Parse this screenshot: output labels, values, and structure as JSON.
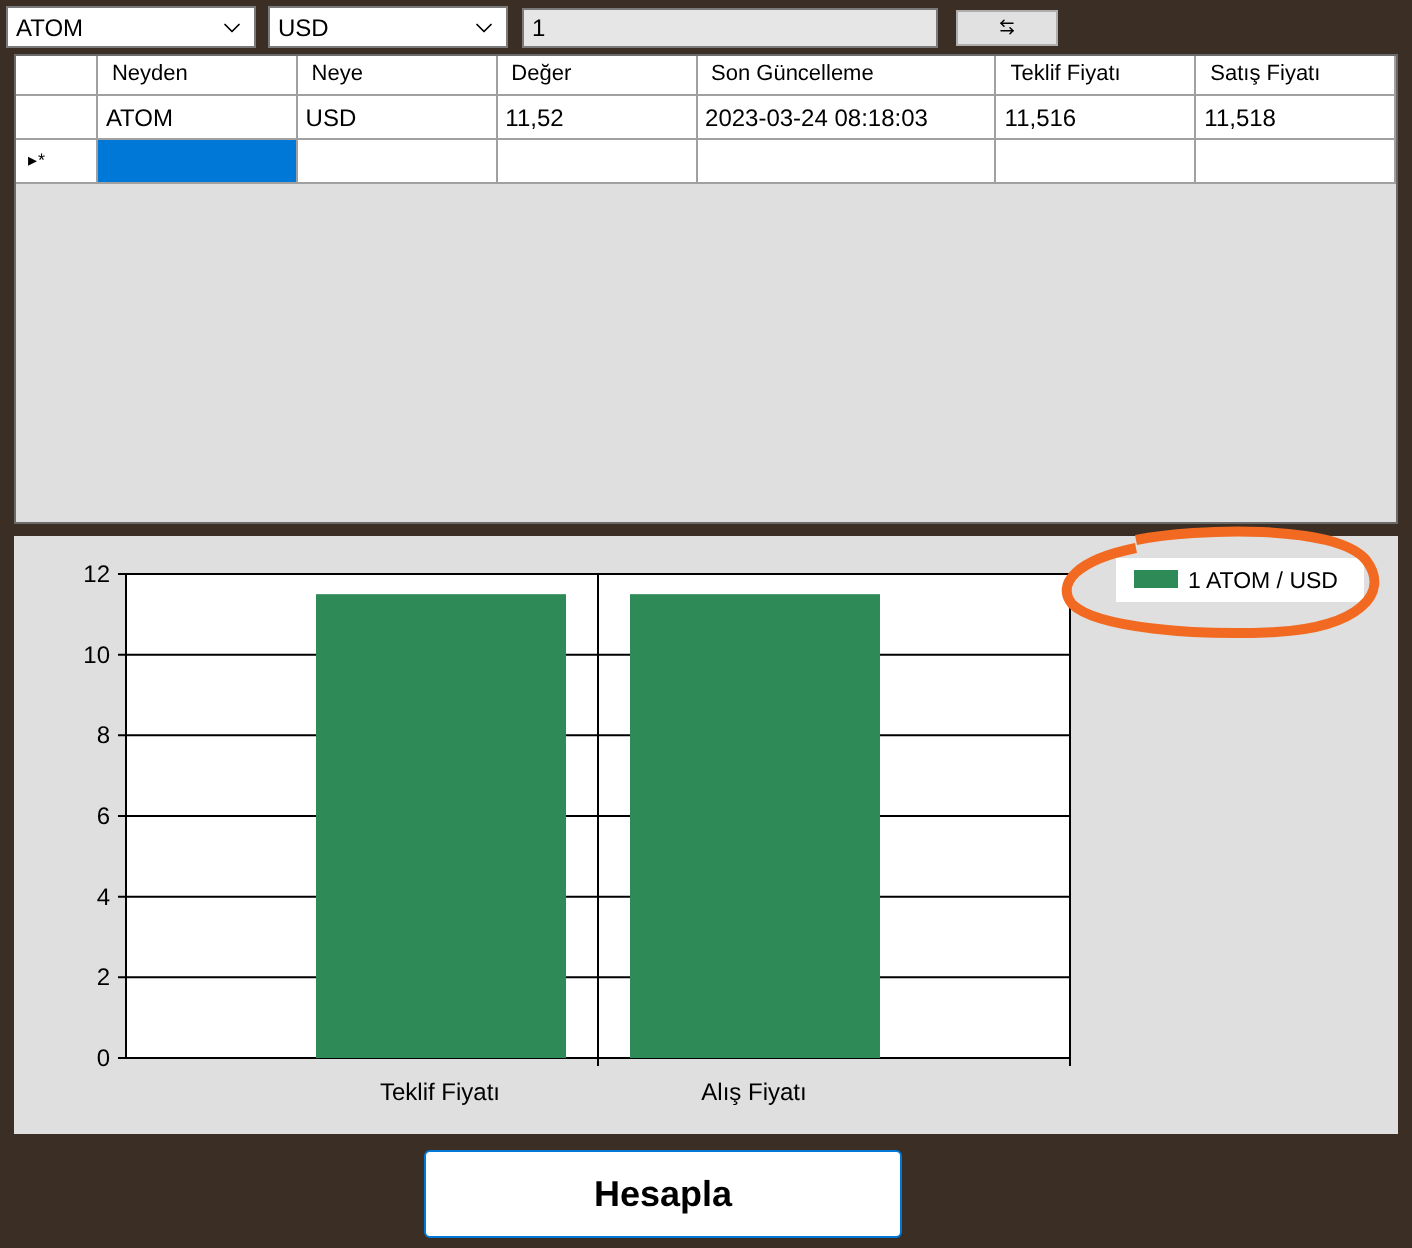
{
  "toolbar": {
    "from_currency": "ATOM",
    "to_currency": "USD",
    "amount": "1"
  },
  "grid": {
    "columns": [
      "Neyden",
      "Neye",
      "Değer",
      "Son Güncelleme",
      "Teklif Fiyatı",
      "Satış Fiyatı"
    ],
    "rows": [
      {
        "selected": false,
        "cells": [
          "ATOM",
          "USD",
          "11,52",
          "2023-03-24 08:18:03",
          "11,516",
          "11,518"
        ]
      }
    ],
    "new_row": {
      "marker": "▸*",
      "cells": [
        {
          "selected": true
        },
        {
          "selected": false
        },
        {
          "selected": false
        },
        {
          "selected": false
        },
        {
          "selected": false
        },
        {
          "selected": false
        }
      ]
    }
  },
  "chart": {
    "chart_data": {
      "type": "bar",
      "categories": [
        "Teklif Fiyatı",
        "Alış Fiyatı"
      ],
      "series": [
        {
          "name": "1 ATOM / USD",
          "color": "#2e8b57",
          "values": [
            11.5,
            11.5
          ]
        }
      ],
      "grid": true,
      "ylim": [
        0,
        12
      ],
      "yticks": [
        0,
        2,
        4,
        6,
        8,
        10,
        12
      ]
    }
  },
  "calculate_button": "Hesapla"
}
